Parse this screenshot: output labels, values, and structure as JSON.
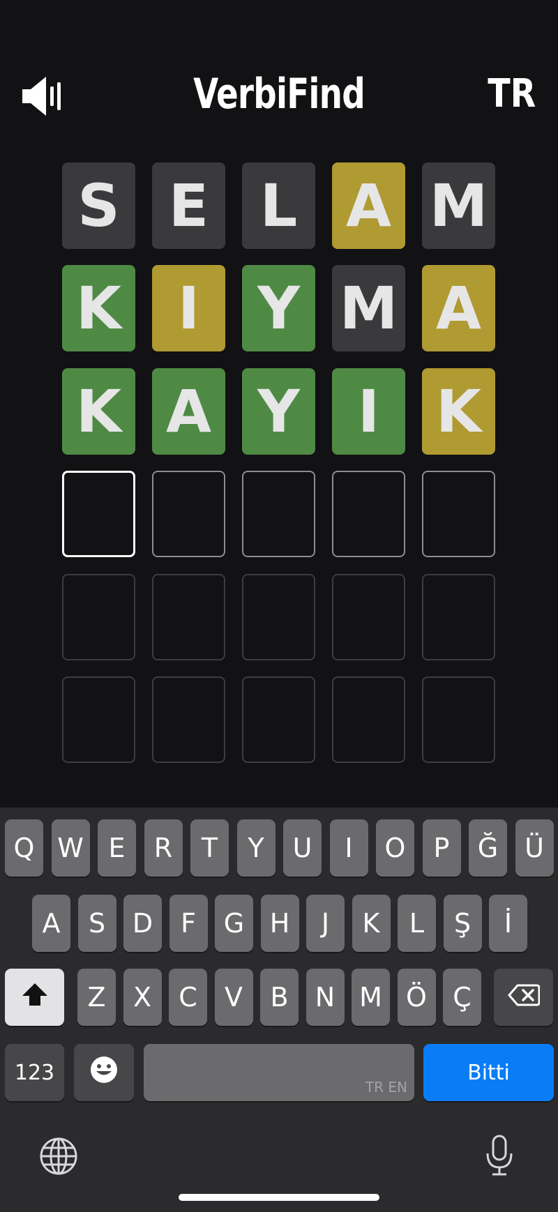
{
  "header": {
    "title": "VerbiFind",
    "language": "TR",
    "sound_icon": "speaker-icon"
  },
  "board": {
    "rows": [
      {
        "tiles": [
          {
            "letter": "S",
            "state": "absent"
          },
          {
            "letter": "E",
            "state": "absent"
          },
          {
            "letter": "L",
            "state": "absent"
          },
          {
            "letter": "A",
            "state": "present"
          },
          {
            "letter": "M",
            "state": "absent"
          }
        ]
      },
      {
        "tiles": [
          {
            "letter": "K",
            "state": "correct"
          },
          {
            "letter": "I",
            "state": "present"
          },
          {
            "letter": "Y",
            "state": "correct"
          },
          {
            "letter": "M",
            "state": "absent"
          },
          {
            "letter": "A",
            "state": "present"
          }
        ]
      },
      {
        "tiles": [
          {
            "letter": "K",
            "state": "correct"
          },
          {
            "letter": "A",
            "state": "correct"
          },
          {
            "letter": "Y",
            "state": "correct"
          },
          {
            "letter": "I",
            "state": "correct"
          },
          {
            "letter": "K",
            "state": "present"
          }
        ]
      },
      {
        "tiles": [
          {
            "letter": "",
            "state": "active"
          },
          {
            "letter": "",
            "state": "active"
          },
          {
            "letter": "",
            "state": "active"
          },
          {
            "letter": "",
            "state": "active"
          },
          {
            "letter": "",
            "state": "active"
          }
        ]
      },
      {
        "tiles": [
          {
            "letter": "",
            "state": "empty"
          },
          {
            "letter": "",
            "state": "empty"
          },
          {
            "letter": "",
            "state": "empty"
          },
          {
            "letter": "",
            "state": "empty"
          },
          {
            "letter": "",
            "state": "empty"
          }
        ]
      },
      {
        "tiles": [
          {
            "letter": "",
            "state": "empty"
          },
          {
            "letter": "",
            "state": "empty"
          },
          {
            "letter": "",
            "state": "empty"
          },
          {
            "letter": "",
            "state": "empty"
          },
          {
            "letter": "",
            "state": "empty"
          }
        ]
      }
    ]
  },
  "keyboard": {
    "row1": [
      "Q",
      "W",
      "E",
      "R",
      "T",
      "Y",
      "U",
      "I",
      "O",
      "P",
      "Ğ",
      "Ü"
    ],
    "row2": [
      "A",
      "S",
      "D",
      "F",
      "G",
      "H",
      "J",
      "K",
      "L",
      "Ş",
      "İ"
    ],
    "row3": [
      "Z",
      "X",
      "C",
      "V",
      "B",
      "N",
      "M",
      "Ö",
      "Ç"
    ],
    "numbers_label": "123",
    "done_label": "Bitti",
    "space_language_hint": "TR EN",
    "icons": [
      "shift-icon",
      "backspace-icon",
      "emoji-icon",
      "globe-icon",
      "microphone-icon"
    ]
  },
  "colors": {
    "absent": "#3a3a3c",
    "present": "#b09a32",
    "correct": "#4f8a45",
    "done_key": "#0a7df6"
  }
}
